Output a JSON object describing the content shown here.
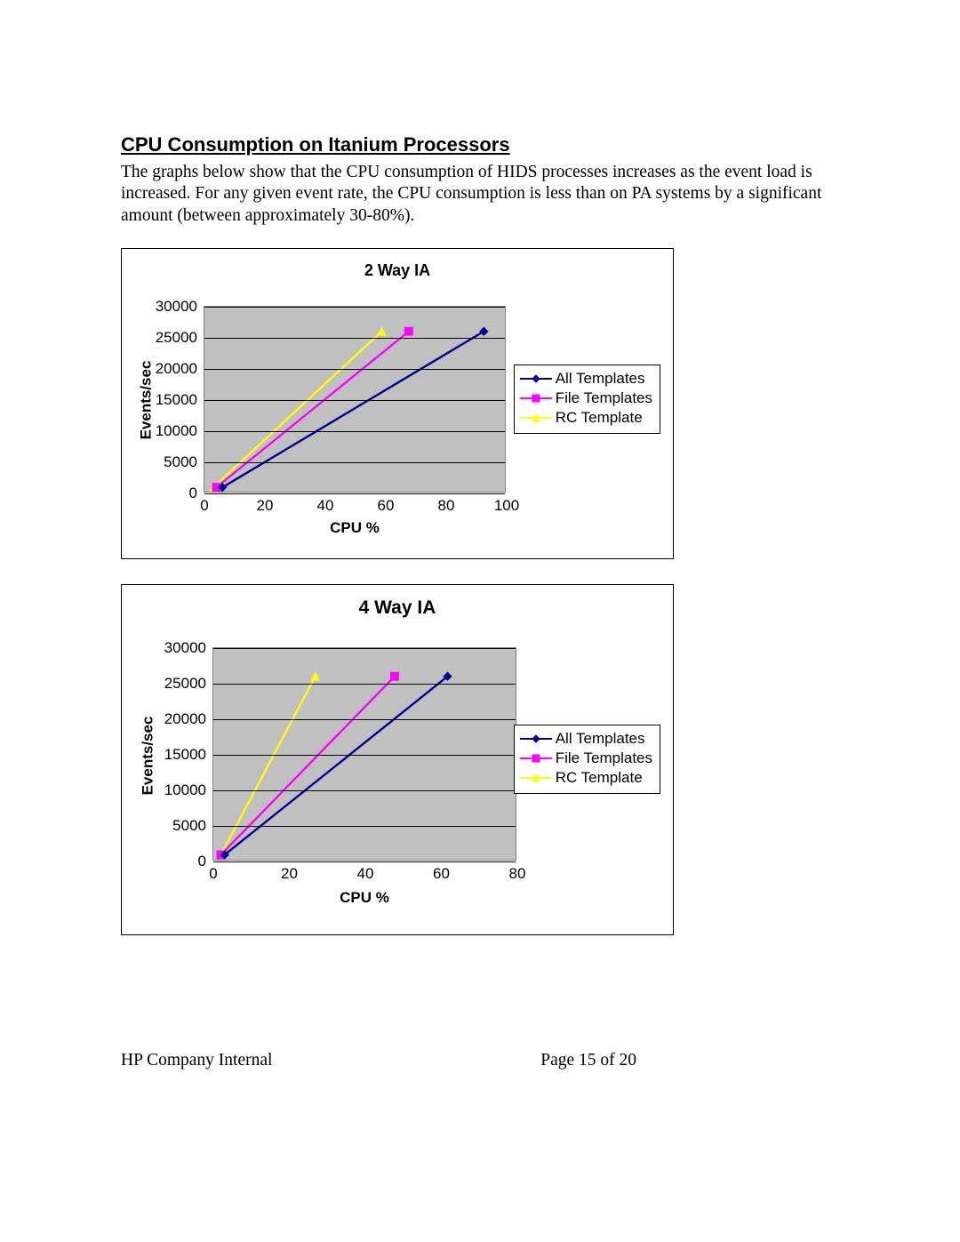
{
  "section_title": "CPU Consumption on Itanium Processors",
  "body_text": "The graphs below show that the CPU consumption of HIDS processes increases as the event load is increased. For any given event rate, the CPU consumption is less than on PA systems by a significant amount (between approximately 30-80%).",
  "footer_left": "HP Company Internal",
  "footer_center": "Page 15 of 20",
  "chart_data": [
    {
      "type": "line",
      "title": "2 Way IA",
      "xlabel": "CPU %",
      "ylabel": "Events/sec",
      "xlim": [
        0,
        100
      ],
      "ylim": [
        0,
        30000
      ],
      "x_ticks": [
        0,
        20,
        40,
        60,
        80,
        100
      ],
      "y_ticks": [
        0,
        5000,
        10000,
        15000,
        20000,
        25000,
        30000
      ],
      "series": [
        {
          "name": "All Templates",
          "color": "#000099",
          "marker": "diamond",
          "x": [
            6,
            93
          ],
          "y": [
            700,
            26000
          ]
        },
        {
          "name": "File Templates",
          "color": "#ff00ff",
          "marker": "square",
          "x": [
            4,
            68
          ],
          "y": [
            700,
            26000
          ]
        },
        {
          "name": "RC Template",
          "color": "#ffff00",
          "marker": "triangle",
          "x": [
            3,
            59
          ],
          "y": [
            700,
            26000
          ]
        }
      ]
    },
    {
      "type": "line",
      "title": "4 Way IA",
      "xlabel": "CPU %",
      "ylabel": "Events/sec",
      "xlim": [
        0,
        80
      ],
      "ylim": [
        0,
        30000
      ],
      "x_ticks": [
        0,
        20,
        40,
        60,
        80
      ],
      "y_ticks": [
        0,
        5000,
        10000,
        15000,
        20000,
        25000,
        30000
      ],
      "series": [
        {
          "name": "All Templates",
          "color": "#000099",
          "marker": "diamond",
          "x": [
            3,
            62
          ],
          "y": [
            700,
            26000
          ]
        },
        {
          "name": "File Templates",
          "color": "#ff00ff",
          "marker": "square",
          "x": [
            2,
            48
          ],
          "y": [
            700,
            26000
          ]
        },
        {
          "name": "RC Template",
          "color": "#ffff00",
          "marker": "triangle",
          "x": [
            2,
            27
          ],
          "y": [
            700,
            26000
          ]
        }
      ]
    }
  ]
}
